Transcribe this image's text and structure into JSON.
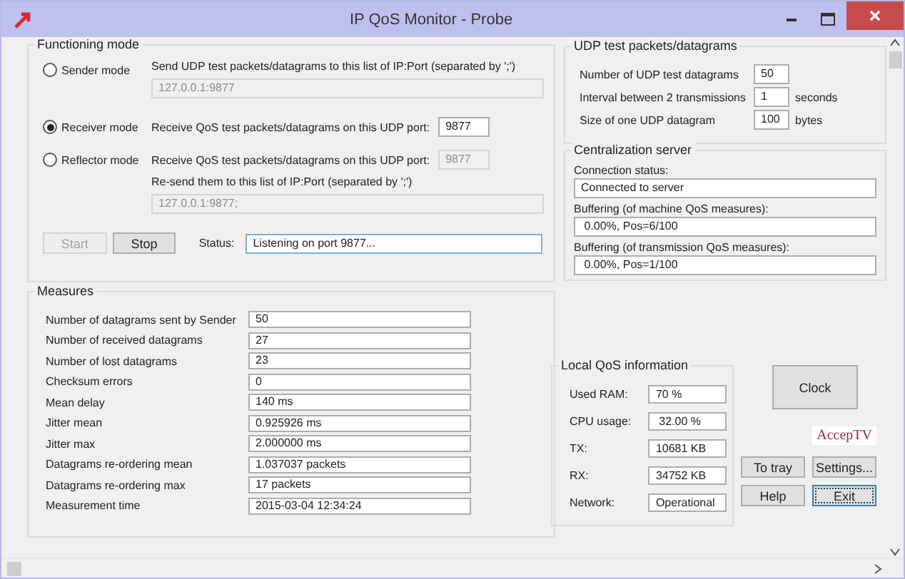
{
  "window": {
    "title": "IP QoS Monitor - Probe"
  },
  "functioning_mode": {
    "title": "Functioning mode",
    "modes": [
      {
        "label": "Sender mode",
        "selected": false,
        "rows": [
          {
            "kind": "below",
            "text": "Send UDP test packets/datagrams to this list of IP:Port (separated by ';')",
            "field": {
              "value": "127.0.0.1:9877",
              "disabled": true
            }
          }
        ]
      },
      {
        "label": "Receiver mode",
        "selected": true,
        "rows": [
          {
            "kind": "inline",
            "text": "Receive QoS test packets/datagrams on this UDP port:",
            "field": {
              "value": "9877",
              "disabled": false
            }
          }
        ]
      },
      {
        "label": "Reflector mode",
        "selected": false,
        "rows": [
          {
            "kind": "inline",
            "text": "Receive QoS test packets/datagrams on this UDP port:",
            "field": {
              "value": "9877",
              "disabled": true
            }
          },
          {
            "kind": "below",
            "text": "Re-send them to this list of IP:Port (separated by ';')",
            "field": {
              "value": "127.0.0.1:9877;",
              "disabled": true
            }
          }
        ]
      }
    ],
    "buttons": [
      {
        "label": "Start",
        "disabled": true
      },
      {
        "label": "Stop",
        "disabled": false
      }
    ],
    "status": {
      "label": "Status:",
      "value": "Listening on port 9877..."
    }
  },
  "measures": {
    "title": "Measures",
    "rows": [
      {
        "label": "Number of datagrams sent by Sender",
        "value": "50"
      },
      {
        "label": "Number of received datagrams",
        "value": "27"
      },
      {
        "label": "Number of lost datagrams",
        "value": "23"
      },
      {
        "label": "Checksum errors",
        "value": "0"
      },
      {
        "label": "Mean delay",
        "value": "140 ms"
      },
      {
        "label": "Jitter mean",
        "value": "0.925926 ms"
      },
      {
        "label": "Jitter max",
        "value": "2.000000 ms"
      },
      {
        "label": "Datagrams re-ordering mean",
        "value": "1.037037 packets"
      },
      {
        "label": "Datagrams re-ordering max",
        "value": "17 packets"
      },
      {
        "label": "Measurement time",
        "value": "2015-03-04 12:34:24"
      }
    ]
  },
  "udp_test": {
    "title": "UDP test packets/datagrams",
    "rows": [
      {
        "label": "Number of UDP test datagrams",
        "value": "50"
      },
      {
        "label": "Interval between 2 transmissions",
        "value": "1",
        "unit": "seconds"
      },
      {
        "label": "Size of one UDP datagram",
        "value": "100",
        "unit": "bytes"
      }
    ]
  },
  "centralization_server": {
    "title": "Centralization server",
    "rows": [
      {
        "label": "Connection status:",
        "value": "Connected to server"
      },
      {
        "label": "Buffering (of machine QoS measures):",
        "value": " 0.00%, Pos=6/100"
      },
      {
        "label": "Buffering (of transmission QoS measures):",
        "value": " 0.00%, Pos=1/100"
      }
    ]
  },
  "local_qos": {
    "title": "Local QoS information",
    "rows": [
      {
        "label": "Used RAM:",
        "value": "70 %"
      },
      {
        "label": "CPU usage:",
        "value": " 32.00 %"
      },
      {
        "label": "TX:",
        "value": "10681 KB"
      },
      {
        "label": "RX:",
        "value": "34752 KB"
      },
      {
        "label": "Network:",
        "value": "Operational"
      }
    ]
  },
  "clock_button": {
    "label": "Clock"
  },
  "logo": {
    "text": "AccepTV"
  },
  "buttons": [
    {
      "label": "To tray",
      "focused": false
    },
    {
      "label": "Settings...",
      "focused": false
    },
    {
      "label": "Help",
      "focused": false
    },
    {
      "label": "Exit",
      "focused": true
    }
  ]
}
